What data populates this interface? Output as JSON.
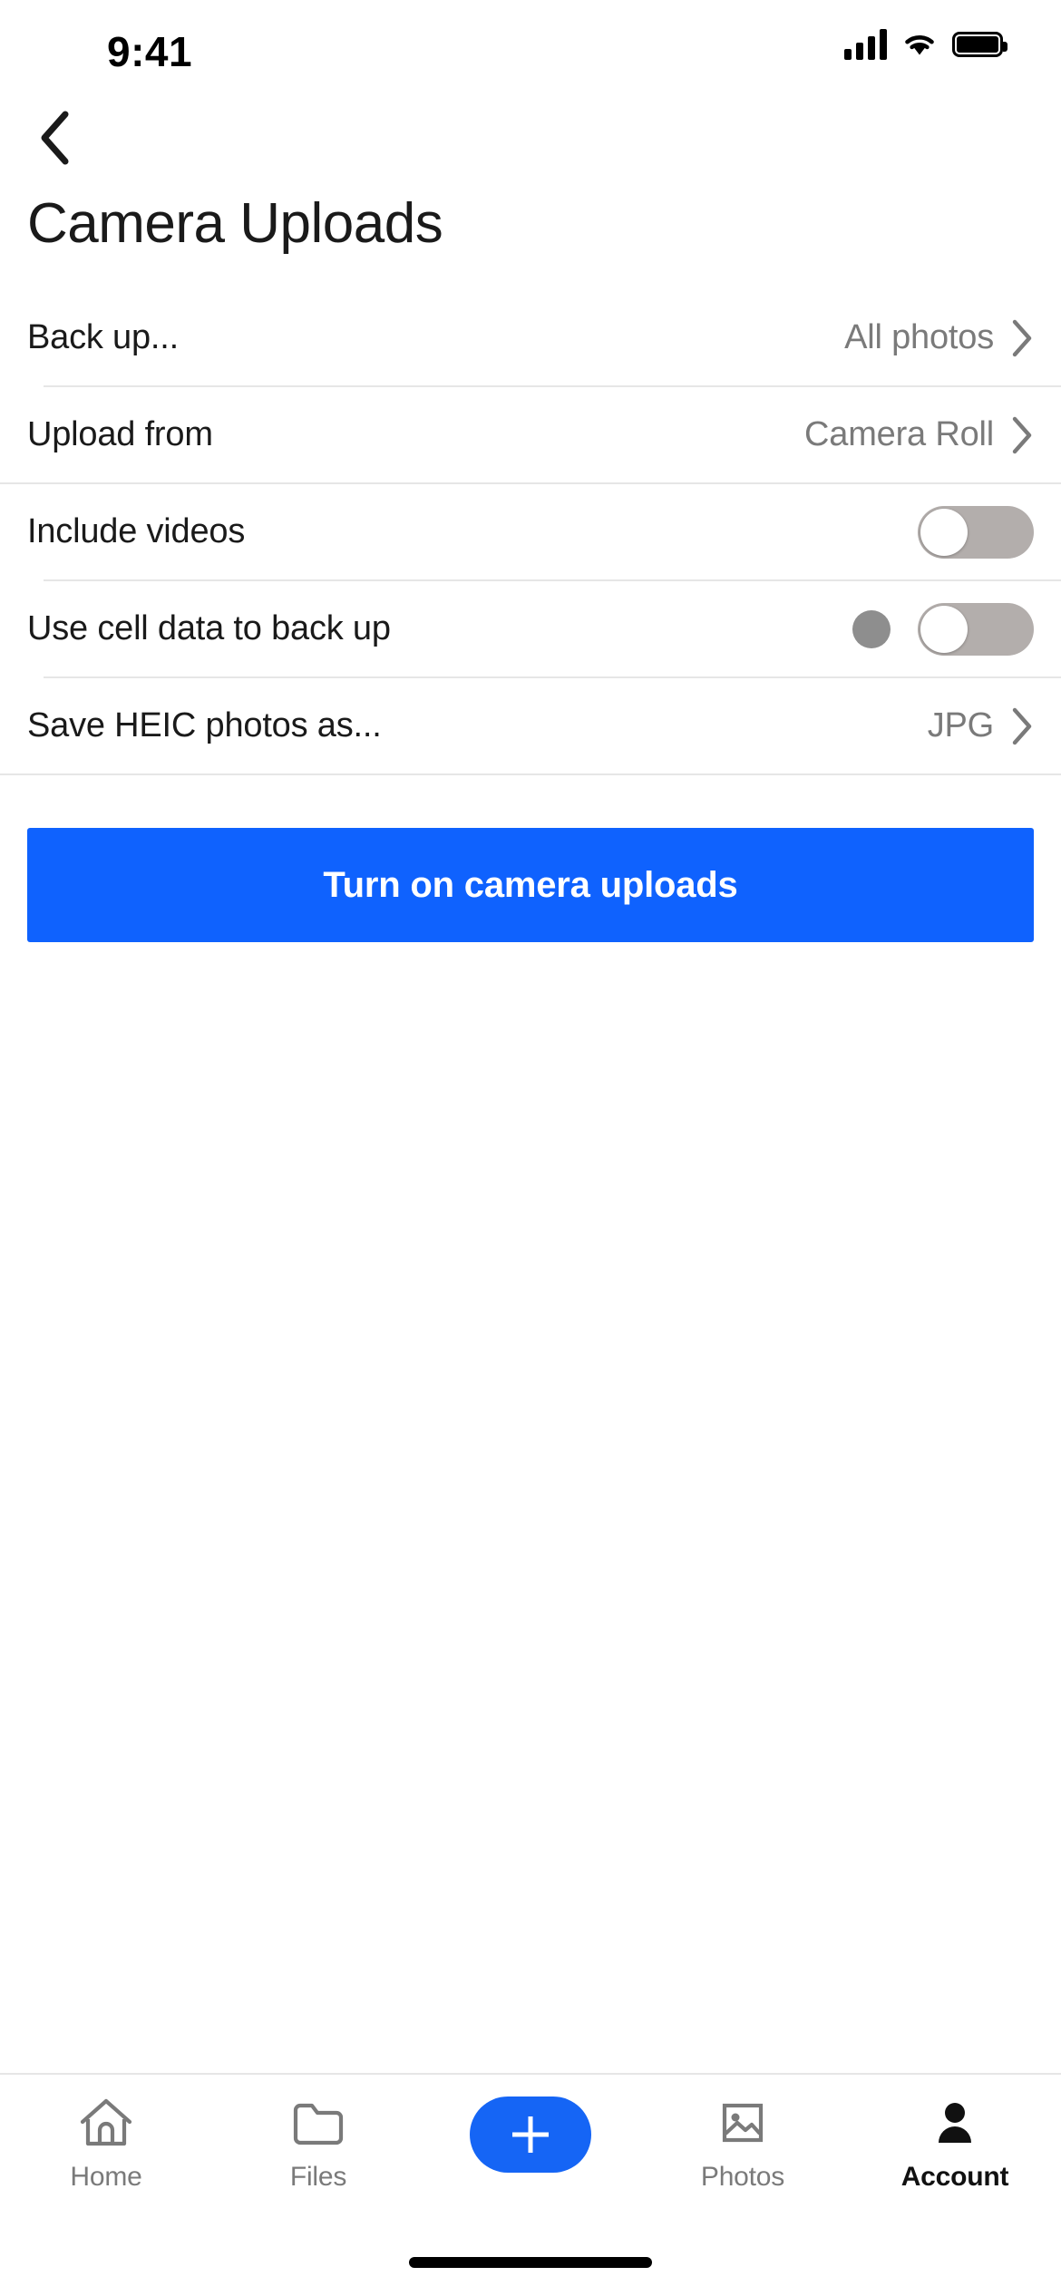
{
  "status_bar": {
    "time": "9:41",
    "cellular_icon": "cellular-bars-icon",
    "wifi_icon": "wifi-icon",
    "battery_icon": "battery-full-icon"
  },
  "nav": {
    "back_icon": "chevron-left-icon"
  },
  "header": {
    "title": "Camera Uploads"
  },
  "settings": {
    "rows": [
      {
        "label": "Back up...",
        "value": "All photos",
        "type": "disclosure",
        "icon": "chevron-right-icon"
      },
      {
        "label": "Upload from",
        "value": "Camera Roll",
        "type": "disclosure",
        "icon": "chevron-right-icon"
      },
      {
        "label": "Include videos",
        "value": "off",
        "type": "toggle"
      },
      {
        "label": "Use cell data to back up",
        "value": "off",
        "type": "toggle",
        "has_indicator_dot": true
      },
      {
        "label": "Save HEIC photos as...",
        "value": "JPG",
        "type": "disclosure",
        "icon": "chevron-right-icon"
      }
    ]
  },
  "cta": {
    "label": "Turn on camera uploads",
    "color": "#0f62fe"
  },
  "tabbar": {
    "items": [
      {
        "label": "Home",
        "icon": "home-icon",
        "active": false
      },
      {
        "label": "Files",
        "icon": "folder-icon",
        "active": false
      },
      {
        "label": "",
        "icon": "plus-icon",
        "active": false,
        "is_fab": true
      },
      {
        "label": "Photos",
        "icon": "photo-icon",
        "active": false
      },
      {
        "label": "Account",
        "icon": "person-icon",
        "active": true
      }
    ]
  },
  "colors": {
    "accent": "#0f62fe",
    "fab": "#1565f5",
    "label": "#1a1a1a",
    "value": "#7a7a7a",
    "divider": "#e6e6e6",
    "toggle_off_track": "#b3aeac"
  }
}
